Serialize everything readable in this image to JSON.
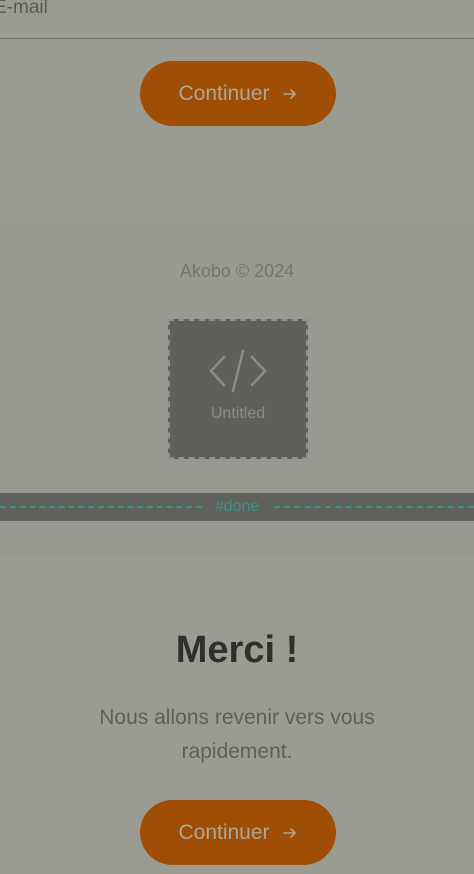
{
  "form": {
    "email_label": "E-mail",
    "continue_label": "Continuer"
  },
  "footer": {
    "copyright": "Akobo © 2024",
    "embed_label": "Untitled",
    "anchor_label": "#done"
  },
  "thanks": {
    "title": "Merci !",
    "message": "Nous allons revenir vers vous rapidement.",
    "continue_label": "Continuer"
  },
  "colors": {
    "background": "#9a9c92",
    "accent": "#a04e05",
    "anchor": "#3e8f86"
  },
  "icons": {
    "button_arrow": "arrow-right-icon",
    "embed": "code-icon"
  }
}
